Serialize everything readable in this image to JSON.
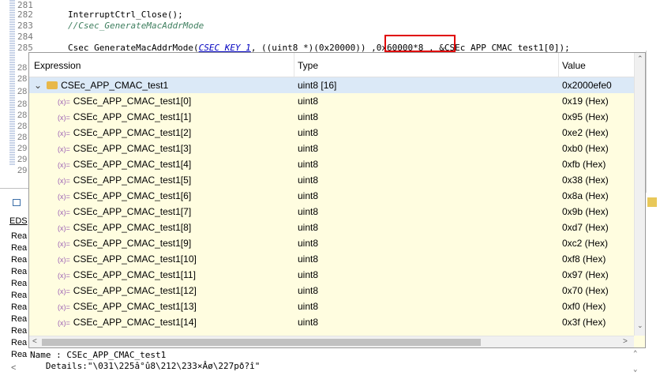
{
  "editor": {
    "lines": [
      {
        "num": "281",
        "text": ""
      },
      {
        "num": "282",
        "text": "InterruptCtrl_Close();"
      },
      {
        "num": "283",
        "text": "//Csec_GenerateMacAddrMode"
      },
      {
        "num": "284",
        "text": ""
      },
      {
        "num": "285",
        "pre": "Csec_GenerateMacAddrMode(",
        "key": "CSEC_KEY_1",
        "post": ", ((uint8 *)(0x20000)) ,0x60000*8 , &CSEc_APP_CMAC_test1[0]);"
      }
    ],
    "hidden_line_nums": [
      "28",
      "28",
      "28",
      "28",
      "28",
      "28",
      "28",
      "29",
      "29",
      "29"
    ],
    "highlight_text": ",0x60000*8"
  },
  "background_panel": {
    "tabs": [
      "EDS"
    ],
    "rows": [
      "Rea",
      "Rea",
      "Rea",
      "Rea",
      "Rea",
      "Rea",
      "Rea",
      "Rea",
      "Rea",
      "Rea",
      "Rea",
      "Rea"
    ]
  },
  "popup": {
    "columns": {
      "expression": "Expression",
      "type": "Type",
      "value": "Value"
    },
    "rows": [
      {
        "expr": "CSEc_APP_CMAC_test1",
        "type": "uint8 [16]",
        "value": "0x2000efe0",
        "parent": true
      },
      {
        "expr": "CSEc_APP_CMAC_test1[0]",
        "type": "uint8",
        "value": "0x19 (Hex)"
      },
      {
        "expr": "CSEc_APP_CMAC_test1[1]",
        "type": "uint8",
        "value": "0x95 (Hex)"
      },
      {
        "expr": "CSEc_APP_CMAC_test1[2]",
        "type": "uint8",
        "value": "0xe2 (Hex)"
      },
      {
        "expr": "CSEc_APP_CMAC_test1[3]",
        "type": "uint8",
        "value": "0xb0 (Hex)"
      },
      {
        "expr": "CSEc_APP_CMAC_test1[4]",
        "type": "uint8",
        "value": "0xfb (Hex)"
      },
      {
        "expr": "CSEc_APP_CMAC_test1[5]",
        "type": "uint8",
        "value": "0x38 (Hex)"
      },
      {
        "expr": "CSEc_APP_CMAC_test1[6]",
        "type": "uint8",
        "value": "0x8a (Hex)"
      },
      {
        "expr": "CSEc_APP_CMAC_test1[7]",
        "type": "uint8",
        "value": "0x9b (Hex)"
      },
      {
        "expr": "CSEc_APP_CMAC_test1[8]",
        "type": "uint8",
        "value": "0xd7 (Hex)"
      },
      {
        "expr": "CSEc_APP_CMAC_test1[9]",
        "type": "uint8",
        "value": "0xc2 (Hex)"
      },
      {
        "expr": "CSEc_APP_CMAC_test1[10]",
        "type": "uint8",
        "value": "0xf8 (Hex)"
      },
      {
        "expr": "CSEc_APP_CMAC_test1[11]",
        "type": "uint8",
        "value": "0x97 (Hex)"
      },
      {
        "expr": "CSEc_APP_CMAC_test1[12]",
        "type": "uint8",
        "value": "0x70 (Hex)"
      },
      {
        "expr": "CSEc_APP_CMAC_test1[13]",
        "type": "uint8",
        "value": "0xf0 (Hex)"
      },
      {
        "expr": "CSEc_APP_CMAC_test1[14]",
        "type": "uint8",
        "value": "0x3f (Hex)"
      }
    ],
    "var_icon": "(x)=",
    "expand_icon": "⌄"
  },
  "details": {
    "name_line": "Name : CSEc_APP_CMAC_test1",
    "details_line": "   Details:\"\\031\\225â°û8\\212\\233×Âø\\227pð?î\""
  },
  "colors": {
    "highlight_box": "#e00000",
    "popup_bg": "#fffde0",
    "selected_row": "#dbe9f7"
  }
}
